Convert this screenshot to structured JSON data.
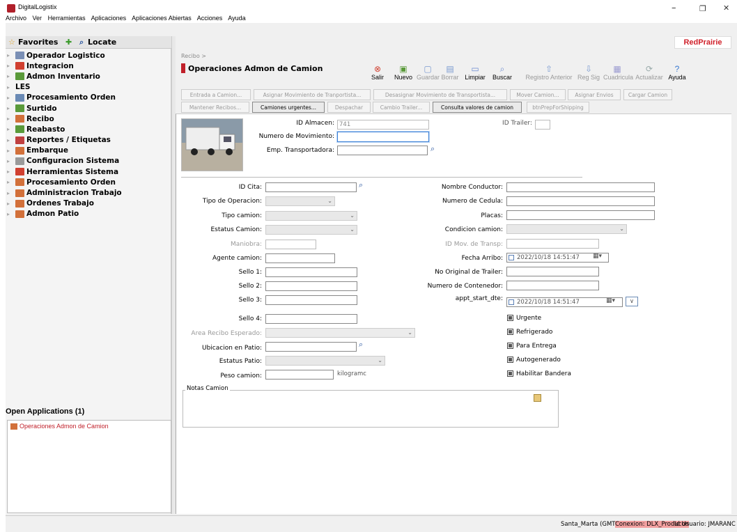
{
  "window": {
    "title": "DigitalLogistix",
    "min": "–",
    "max": "❐",
    "close": "✕"
  },
  "menu": [
    "Archivo",
    "Ver",
    "Herramientas",
    "Aplicaciones",
    "Aplicaciones Abiertas",
    "Acciones",
    "Ayuda"
  ],
  "favbar": {
    "favorites": "Favorites",
    "locate": "Locate"
  },
  "brand": "RedPrairie",
  "tree": [
    {
      "label": "Operador Logistico",
      "color": "#7a8fb5"
    },
    {
      "label": "Integracion",
      "color": "#d04030"
    },
    {
      "label": "Admon Inventario",
      "color": "#5a9a3a"
    },
    {
      "label": "LES",
      "color": ""
    },
    {
      "label": "Procesamiento Orden",
      "color": "#6a8ab5"
    },
    {
      "label": "Surtido",
      "color": "#5a9a3a"
    },
    {
      "label": "Recibo",
      "color": "#d2703a"
    },
    {
      "label": "Reabasto",
      "color": "#5a9a3a"
    },
    {
      "label": "Reportes / Etiquetas",
      "color": "#c04040"
    },
    {
      "label": "Embarque",
      "color": "#d2703a"
    },
    {
      "label": "Configuracion Sistema",
      "color": "#9a9a9a"
    },
    {
      "label": "Herramientas Sistema",
      "color": "#d04030"
    },
    {
      "label": "Procesamiento Orden",
      "color": "#d2703a"
    },
    {
      "label": "Administracion Trabajo",
      "color": "#d2703a"
    },
    {
      "label": "Ordenes Trabajo",
      "color": "#d2703a"
    },
    {
      "label": "Admon Patio",
      "color": "#d2703a"
    }
  ],
  "open_apps": {
    "title": "Open Applications (1)",
    "items": [
      "Operaciones Admon de Camion"
    ]
  },
  "header": {
    "breadcrumb": "Recibo >",
    "title": "Operaciones Admon de Camion"
  },
  "toolbar": [
    {
      "label": "Salir",
      "icon": "exit-icon",
      "glyph": "⊗",
      "enabled": true
    },
    {
      "label": "Nuevo",
      "icon": "new-icon",
      "glyph": "▣",
      "enabled": true
    },
    {
      "label": "Guardar",
      "icon": "save-icon",
      "glyph": "▢",
      "enabled": false
    },
    {
      "label": "Borrar",
      "icon": "delete-icon",
      "glyph": "▤",
      "enabled": false
    },
    {
      "label": "Limpiar",
      "icon": "clear-icon",
      "glyph": "▭",
      "enabled": true
    },
    {
      "label": "Buscar",
      "icon": "search-icon",
      "glyph": "⌕",
      "enabled": true
    },
    {
      "label": "Registro Anterior",
      "icon": "up-arrow-icon",
      "glyph": "⇧",
      "enabled": false
    },
    {
      "label": "Reg Sig",
      "icon": "down-arrow-icon",
      "glyph": "⇩",
      "enabled": false
    },
    {
      "label": "Cuadricula",
      "icon": "grid-icon",
      "glyph": "▦",
      "enabled": false
    },
    {
      "label": "Actualizar",
      "icon": "refresh-icon",
      "glyph": "⟳",
      "enabled": false
    },
    {
      "label": "Ayuda",
      "icon": "help-icon",
      "glyph": "?",
      "enabled": true
    }
  ],
  "actions_row1": [
    {
      "label": "Entrada a Camion...",
      "enabled": false
    },
    {
      "label": "Asignar Movimiento de Tranportista...",
      "enabled": false
    },
    {
      "label": "Desasignar Movimiento de Transportista...",
      "enabled": false
    },
    {
      "label": "Mover Camion...",
      "enabled": false
    },
    {
      "label": "Asignar Envios",
      "enabled": false
    },
    {
      "label": "Cargar Camion",
      "enabled": false
    }
  ],
  "actions_row2": [
    {
      "label": "Mantener Recibos...",
      "enabled": false
    },
    {
      "label": "Camiones urgentes...",
      "enabled": true
    },
    {
      "label": "Despachar",
      "enabled": false
    },
    {
      "label": "Cambio Trailer...",
      "enabled": false
    },
    {
      "label": "Consulta valores de camion",
      "enabled": true
    },
    {
      "label": "btnPrepForShipping",
      "enabled": false
    }
  ],
  "form": {
    "id_almacen": {
      "label": "ID Almacen:",
      "value": "741"
    },
    "id_trailer": {
      "label": "ID Trailer:",
      "value": ""
    },
    "numero_movimiento": {
      "label": "Numero de Movimiento:",
      "value": ""
    },
    "emp_transportadora": {
      "label": "Emp. Transportadora:",
      "value": ""
    },
    "id_cita": {
      "label": "ID Cita:",
      "value": ""
    },
    "tipo_operacion": {
      "label": "Tipo de Operacion:",
      "value": ""
    },
    "tipo_camion": {
      "label": "Tipo camion:",
      "value": ""
    },
    "estatus_camion": {
      "label": "Estatus Camion:",
      "value": ""
    },
    "maniobra": {
      "label": "Maniobra:",
      "value": ""
    },
    "agente_camion": {
      "label": "Agente camion:",
      "value": ""
    },
    "sello1": {
      "label": "Sello 1:",
      "value": ""
    },
    "sello2": {
      "label": "Sello 2:",
      "value": ""
    },
    "sello3": {
      "label": "Sello 3:",
      "value": ""
    },
    "sello4": {
      "label": "Sello 4:",
      "value": ""
    },
    "area_recibo": {
      "label": "Area Recibo Esperado:",
      "value": ""
    },
    "ubicacion_patio": {
      "label": "Ubicacion en Patio:",
      "value": ""
    },
    "estatus_patio": {
      "label": "Estatus Patio:",
      "value": ""
    },
    "peso_camion": {
      "label": "Peso camion:",
      "value": "",
      "unit": "kilogramc"
    },
    "nombre_conductor": {
      "label": "Nombre Conductor:",
      "value": ""
    },
    "numero_cedula": {
      "label": "Numero de Cedula:",
      "value": ""
    },
    "placas": {
      "label": "Placas:",
      "value": ""
    },
    "condicion_camion": {
      "label": "Condicion camion:",
      "value": ""
    },
    "id_mov_transp": {
      "label": "ID Mov. de Transp:",
      "value": ""
    },
    "fecha_arribo": {
      "label": "Fecha Arribo:",
      "value": "2022/10/18 14:51:47"
    },
    "no_original_trailer": {
      "label": "No Original de Trailer:",
      "value": ""
    },
    "numero_contenedor": {
      "label": "Numero de Contenedor:",
      "value": ""
    },
    "appt_start_dte": {
      "label": "appt_start_dte:",
      "value": "2022/10/18 14:51:47"
    },
    "checks": [
      "Urgente",
      "Refrigerado",
      "Para Entrega",
      "Autogenerado",
      "Habilitar Bandera"
    ],
    "notas": {
      "label": "Notas Camion",
      "value": ""
    }
  },
  "status": {
    "zone": "Santa_Marta (GMT)",
    "conexion": "Conexion: DLX_Producon",
    "usuario": "Id Usuario: JMARANC"
  }
}
